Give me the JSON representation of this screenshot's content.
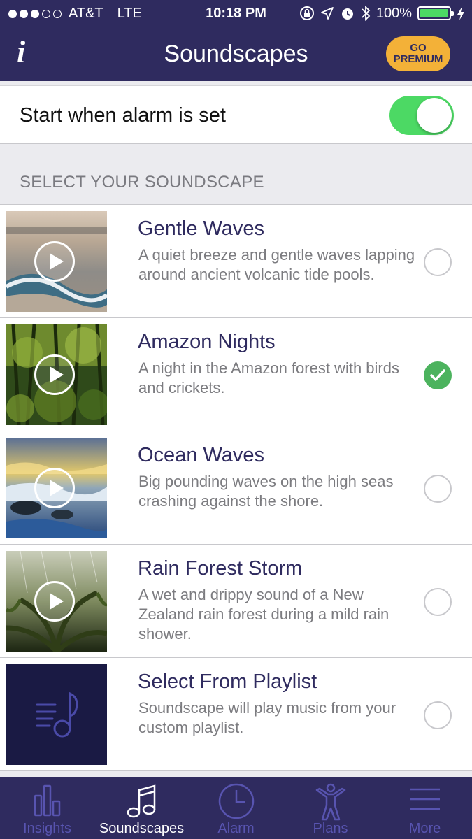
{
  "status_bar": {
    "carrier": "AT&T",
    "network": "LTE",
    "time": "10:18 PM",
    "battery": "100%",
    "signal_bars_filled": 3,
    "signal_bars_total": 5,
    "icons": [
      "lock-rotation-icon",
      "location-icon",
      "alarm-icon",
      "bluetooth-icon",
      "battery-icon",
      "charging-icon"
    ]
  },
  "nav": {
    "info_label": "i",
    "title": "Soundscapes",
    "premium_label": "GO PREMIUM"
  },
  "alarm_toggle": {
    "label": "Start when alarm is set",
    "on": true
  },
  "section_header": "SELECT YOUR SOUNDSCAPE",
  "soundscapes": [
    {
      "title": "Gentle Waves",
      "description": "A quiet breeze and gentle waves lapping around ancient volcanic tide pools.",
      "selected": false
    },
    {
      "title": "Amazon Nights",
      "description": "A night in the Amazon forest with birds and crickets.",
      "selected": true
    },
    {
      "title": "Ocean Waves",
      "description": "Big pounding waves on the high seas crashing against the shore.",
      "selected": false
    },
    {
      "title": "Rain Forest Storm",
      "description": "A wet and drippy sound of a New Zealand rain forest during a mild rain shower.",
      "selected": false
    },
    {
      "title": "Select From Playlist",
      "description": "Soundscape will play music from your custom playlist.",
      "selected": false
    }
  ],
  "tabs": [
    {
      "label": "Insights",
      "icon": "bar-chart-icon",
      "active": false
    },
    {
      "label": "Soundscapes",
      "icon": "music-note-icon",
      "active": true
    },
    {
      "label": "Alarm",
      "icon": "clock-icon",
      "active": false
    },
    {
      "label": "Plans",
      "icon": "person-icon",
      "active": false
    },
    {
      "label": "More",
      "icon": "menu-icon",
      "active": false
    }
  ],
  "colors": {
    "brand_purple": "#2f2b5f",
    "premium_gold": "#f3b138",
    "toggle_green": "#4cd964",
    "check_green": "#4cb35e",
    "inactive_tab": "#5854b0"
  }
}
